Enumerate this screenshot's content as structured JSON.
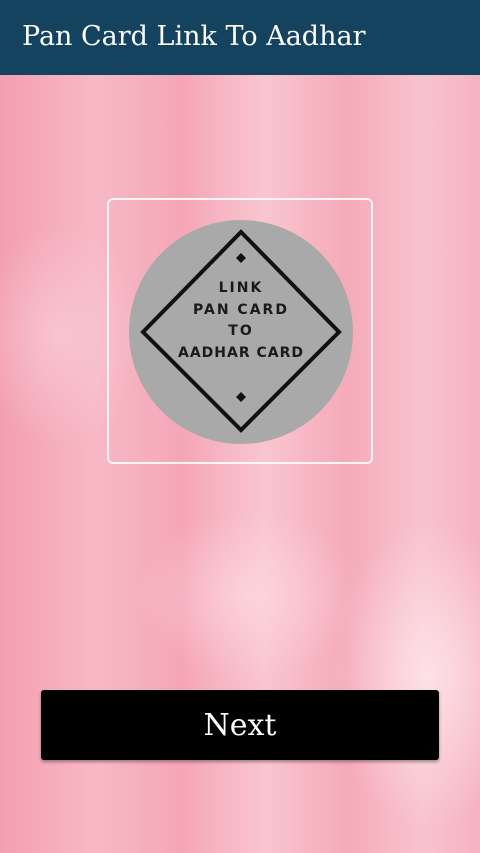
{
  "app_bar": {
    "title": "Pan Card Link To Aadhar",
    "color": "#13435f"
  },
  "logo": {
    "lines": [
      "LINK",
      "PAN CARD",
      "TO",
      "AADHAR CARD"
    ],
    "circle_color": "#a9a9a9"
  },
  "actions": {
    "next_label": "Next"
  }
}
